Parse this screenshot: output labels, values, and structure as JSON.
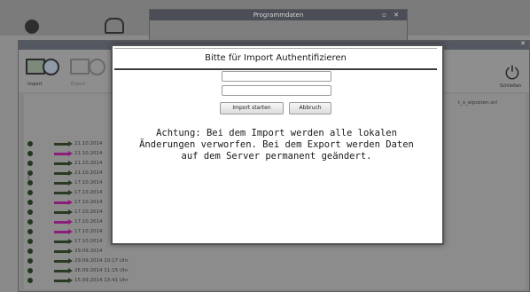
{
  "background": {
    "top_title": "",
    "top_right": "",
    "programmdaten_window": {
      "title": "Programmdaten",
      "controls": "▫ ✕"
    },
    "main_window": {
      "close_glyph": "✕",
      "toolbar": {
        "import_label": "Import",
        "export_label": "Export",
        "close_label": "Schließen"
      },
      "filename": "t_x_eiposten.sol",
      "left_marker": "E",
      "rows": [
        {
          "dir": "in",
          "date": "21.10.2014"
        },
        {
          "dir": "out",
          "date": "21.10.2014"
        },
        {
          "dir": "in",
          "date": "21.10.2014"
        },
        {
          "dir": "in",
          "date": "21.10.2014"
        },
        {
          "dir": "in",
          "date": "17.10.2014"
        },
        {
          "dir": "in",
          "date": "17.10.2014"
        },
        {
          "dir": "out",
          "date": "17.10.2014"
        },
        {
          "dir": "in",
          "date": "17.10.2014"
        },
        {
          "dir": "out",
          "date": "17.10.2014"
        },
        {
          "dir": "out",
          "date": "17.10.2014"
        },
        {
          "dir": "in",
          "date": "17.10.2014"
        },
        {
          "dir": "in",
          "date": "29.09.2014"
        },
        {
          "dir": "in",
          "date": "29.09.2014 10:17 Uhr"
        },
        {
          "dir": "in",
          "date": "26.09.2014 11:15 Uhr"
        },
        {
          "dir": "in",
          "date": "15.09.2014 13:41 Uhr"
        }
      ]
    }
  },
  "modal": {
    "title": "Bitte für Import Authentifizieren",
    "username_value": "",
    "password_value": "",
    "import_button": "Import starten",
    "cancel_button": "Abbruch",
    "message_lines": [
      "Achtung: Bei dem Import werden alle lokalen",
      "Änderungen verworfen. Bei dem Export werden Daten",
      "auf dem Server permanent geändert."
    ]
  }
}
